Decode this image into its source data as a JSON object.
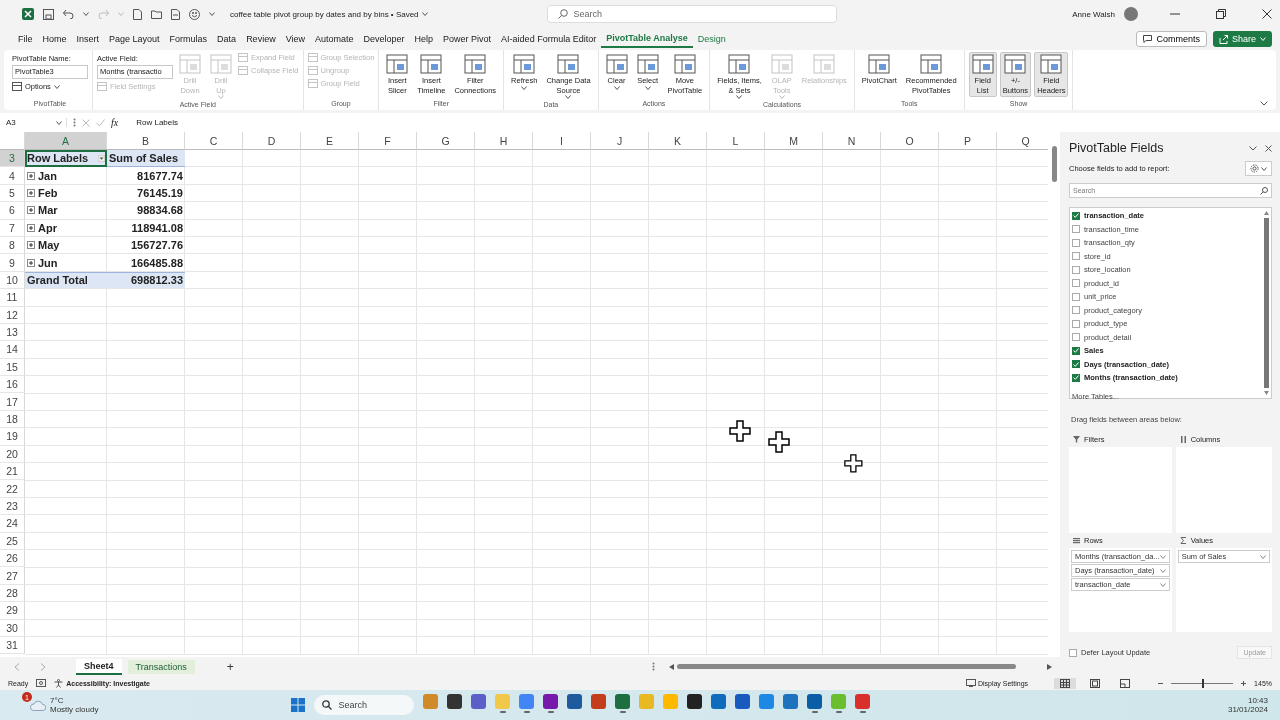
{
  "title_bar": {
    "document_title": "coffee table pivot group by dates and by bins • Saved",
    "search_placeholder": "Search",
    "user_name": "Anne Walsh"
  },
  "ribbon_tabs": [
    {
      "label": "File",
      "selected": false,
      "kind": "standard"
    },
    {
      "label": "Home",
      "selected": false,
      "kind": "standard"
    },
    {
      "label": "Insert",
      "selected": false,
      "kind": "standard"
    },
    {
      "label": "Page Layout",
      "selected": false,
      "kind": "standard"
    },
    {
      "label": "Formulas",
      "selected": false,
      "kind": "standard"
    },
    {
      "label": "Data",
      "selected": false,
      "kind": "standard"
    },
    {
      "label": "Review",
      "selected": false,
      "kind": "standard"
    },
    {
      "label": "View",
      "selected": false,
      "kind": "standard"
    },
    {
      "label": "Automate",
      "selected": false,
      "kind": "standard"
    },
    {
      "label": "Developer",
      "selected": false,
      "kind": "standard"
    },
    {
      "label": "Help",
      "selected": false,
      "kind": "standard"
    },
    {
      "label": "Power Pivot",
      "selected": false,
      "kind": "standard"
    },
    {
      "label": "AI-aided Formula Editor",
      "selected": false,
      "kind": "standard"
    },
    {
      "label": "PivotTable Analyse",
      "selected": true,
      "kind": "contextual"
    },
    {
      "label": "Design",
      "selected": false,
      "kind": "contextual"
    }
  ],
  "comments_button": "Comments",
  "share_button": "Share",
  "ribbon": {
    "groups": [
      {
        "label": "PivotTable",
        "columns": [
          [
            {
              "kind": "label",
              "text": "PivotTable Name:"
            },
            {
              "kind": "input",
              "value": "PivotTable3"
            },
            {
              "kind": "small",
              "label": "Options",
              "caret": true,
              "disabled": false
            }
          ]
        ]
      },
      {
        "label": "Active Field",
        "columns": [
          [
            {
              "kind": "label",
              "text": "Active Field:"
            },
            {
              "kind": "input",
              "value": "Months (transactio"
            },
            {
              "kind": "small",
              "label": "Field Settings",
              "caret": false,
              "disabled": true
            }
          ],
          [
            {
              "kind": "large",
              "lines": [
                "Drill",
                "Down"
              ],
              "caret": false,
              "disabled": true,
              "pressed": false
            }
          ],
          [
            {
              "kind": "large",
              "lines": [
                "Drill",
                "Up"
              ],
              "caret": true,
              "disabled": true,
              "pressed": false
            }
          ],
          [
            {
              "kind": "small",
              "label": "Expand Field",
              "caret": false,
              "disabled": true
            },
            {
              "kind": "small",
              "label": "Collapse Field",
              "caret": false,
              "disabled": true
            }
          ]
        ]
      },
      {
        "label": "Group",
        "columns": [
          [
            {
              "kind": "small",
              "label": "Group Selection",
              "caret": false,
              "disabled": true
            },
            {
              "kind": "small",
              "label": "Ungroup",
              "caret": false,
              "disabled": true
            },
            {
              "kind": "small",
              "label": "Group Field",
              "caret": false,
              "disabled": true
            }
          ]
        ]
      },
      {
        "label": "Filter",
        "columns": [
          [
            {
              "kind": "large",
              "lines": [
                "Insert",
                "Slicer"
              ],
              "caret": false,
              "disabled": false,
              "pressed": false
            }
          ],
          [
            {
              "kind": "large",
              "lines": [
                "Insert",
                "Timeline"
              ],
              "caret": false,
              "disabled": false,
              "pressed": false
            }
          ],
          [
            {
              "kind": "large",
              "lines": [
                "Filter",
                "Connections"
              ],
              "caret": false,
              "disabled": false,
              "pressed": false
            }
          ]
        ]
      },
      {
        "label": "Data",
        "columns": [
          [
            {
              "kind": "large",
              "lines": [
                "Refresh"
              ],
              "caret": true,
              "disabled": false,
              "pressed": false
            }
          ],
          [
            {
              "kind": "large",
              "lines": [
                "Change Data",
                "Source"
              ],
              "caret": true,
              "disabled": false,
              "pressed": false
            }
          ]
        ]
      },
      {
        "label": "Actions",
        "columns": [
          [
            {
              "kind": "large",
              "lines": [
                "Clear"
              ],
              "caret": true,
              "disabled": false,
              "pressed": false
            }
          ],
          [
            {
              "kind": "large",
              "lines": [
                "Select"
              ],
              "caret": true,
              "disabled": false,
              "pressed": false
            }
          ],
          [
            {
              "kind": "large",
              "lines": [
                "Move",
                "PivotTable"
              ],
              "caret": false,
              "disabled": false,
              "pressed": false
            }
          ]
        ]
      },
      {
        "label": "Calculations",
        "columns": [
          [
            {
              "kind": "large",
              "lines": [
                "Fields, Items,",
                "& Sets"
              ],
              "caret": true,
              "disabled": false,
              "pressed": false
            }
          ],
          [
            {
              "kind": "large",
              "lines": [
                "OLAP",
                "Tools"
              ],
              "caret": true,
              "disabled": true,
              "pressed": false
            }
          ],
          [
            {
              "kind": "large",
              "lines": [
                "Relationships"
              ],
              "caret": false,
              "disabled": true,
              "pressed": false
            }
          ]
        ]
      },
      {
        "label": "Tools",
        "columns": [
          [
            {
              "kind": "large",
              "lines": [
                "PivotChart"
              ],
              "caret": false,
              "disabled": false,
              "pressed": false
            }
          ],
          [
            {
              "kind": "large",
              "lines": [
                "Recommended",
                "PivotTables"
              ],
              "caret": false,
              "disabled": false,
              "pressed": false
            }
          ]
        ]
      },
      {
        "label": "Show",
        "columns": [
          [
            {
              "kind": "large",
              "lines": [
                "Field",
                "List"
              ],
              "caret": false,
              "disabled": false,
              "pressed": true
            }
          ],
          [
            {
              "kind": "large",
              "lines": [
                "+/-",
                "Buttons"
              ],
              "caret": false,
              "disabled": false,
              "pressed": true
            }
          ],
          [
            {
              "kind": "large",
              "lines": [
                "Field",
                "Headers"
              ],
              "caret": false,
              "disabled": false,
              "pressed": true
            }
          ]
        ]
      }
    ]
  },
  "formula_bar": {
    "name_box": "A3",
    "function_label": "fx",
    "formula": "Row Labels"
  },
  "sheet": {
    "columns": [
      {
        "label": "A",
        "selected": true
      },
      {
        "label": "B",
        "selected": false
      },
      {
        "label": "C",
        "selected": false
      },
      {
        "label": "D",
        "selected": false
      },
      {
        "label": "E",
        "selected": false
      },
      {
        "label": "F",
        "selected": false
      },
      {
        "label": "G",
        "selected": false
      },
      {
        "label": "H",
        "selected": false
      },
      {
        "label": "I",
        "selected": false
      },
      {
        "label": "J",
        "selected": false
      },
      {
        "label": "K",
        "selected": false
      },
      {
        "label": "L",
        "selected": false
      },
      {
        "label": "M",
        "selected": false
      },
      {
        "label": "N",
        "selected": false
      },
      {
        "label": "O",
        "selected": false
      },
      {
        "label": "P",
        "selected": false
      },
      {
        "label": "Q",
        "selected": false
      }
    ],
    "rows": [
      {
        "label": "3",
        "selected": true
      },
      {
        "label": "4",
        "selected": false
      },
      {
        "label": "5",
        "selected": false
      },
      {
        "label": "6",
        "selected": false
      },
      {
        "label": "7",
        "selected": false
      },
      {
        "label": "8",
        "selected": false
      },
      {
        "label": "9",
        "selected": false
      },
      {
        "label": "10",
        "selected": false
      },
      {
        "label": "11",
        "selected": false
      },
      {
        "label": "12",
        "selected": false
      },
      {
        "label": "13",
        "selected": false
      },
      {
        "label": "14",
        "selected": false
      },
      {
        "label": "15",
        "selected": false
      },
      {
        "label": "16",
        "selected": false
      },
      {
        "label": "17",
        "selected": false
      },
      {
        "label": "18",
        "selected": false
      },
      {
        "label": "19",
        "selected": false
      },
      {
        "label": "20",
        "selected": false
      },
      {
        "label": "21",
        "selected": false
      },
      {
        "label": "22",
        "selected": false
      },
      {
        "label": "23",
        "selected": false
      },
      {
        "label": "24",
        "selected": false
      },
      {
        "label": "25",
        "selected": false
      },
      {
        "label": "26",
        "selected": false
      },
      {
        "label": "27",
        "selected": false
      },
      {
        "label": "28",
        "selected": false
      },
      {
        "label": "29",
        "selected": false
      },
      {
        "label": "30",
        "selected": false
      },
      {
        "label": "31",
        "selected": false
      }
    ],
    "pivot": {
      "headers": [
        {
          "label": "Row Labels",
          "selected": true
        },
        {
          "label": "Sum of Sales",
          "selected": false
        }
      ],
      "rows": [
        {
          "label": "Jan",
          "value": "81677.74",
          "expanded": false
        },
        {
          "label": "Feb",
          "value": "76145.19",
          "expanded": false
        },
        {
          "label": "Mar",
          "value": "98834.68",
          "expanded": false
        },
        {
          "label": "Apr",
          "value": "118941.08",
          "expanded": false
        },
        {
          "label": "May",
          "value": "156727.76",
          "expanded": false
        },
        {
          "label": "Jun",
          "value": "166485.88",
          "expanded": false
        }
      ],
      "total": {
        "label": "Grand Total",
        "value": "698812.33"
      }
    }
  },
  "pivot_fields": {
    "title": "PivotTable Fields",
    "subtitle": "Choose fields to add to report:",
    "search_placeholder": "Search",
    "fields": [
      {
        "name": "transaction_date",
        "checked": true
      },
      {
        "name": "transaction_time",
        "checked": false
      },
      {
        "name": "transaction_qty",
        "checked": false
      },
      {
        "name": "store_id",
        "checked": false
      },
      {
        "name": "store_location",
        "checked": false
      },
      {
        "name": "product_id",
        "checked": false
      },
      {
        "name": "unit_price",
        "checked": false
      },
      {
        "name": "product_category",
        "checked": false
      },
      {
        "name": "product_type",
        "checked": false
      },
      {
        "name": "product_detail",
        "checked": false
      },
      {
        "name": "Sales",
        "checked": true
      },
      {
        "name": "Days (transaction_date)",
        "checked": true
      },
      {
        "name": "Months (transaction_date)",
        "checked": true
      }
    ],
    "more_tables": "More Tables...",
    "drag_hint": "Drag fields between areas below:",
    "areas": [
      {
        "label": "Filters",
        "kind": "filters"
      },
      {
        "label": "Columns",
        "kind": "columns"
      },
      {
        "label": "Rows",
        "kind": "rows",
        "items": [
          "Months (transaction_da...",
          "Days (transaction_date)",
          "transaction_date"
        ]
      },
      {
        "label": "Values",
        "kind": "values",
        "items": [
          "Sum of Sales"
        ]
      }
    ],
    "defer_update": {
      "label": "Defer Layout Update",
      "checked": false
    },
    "update_button": {
      "label": "Update",
      "disabled": true
    }
  },
  "sheet_tabs": [
    {
      "label": "Sheet4",
      "selected": true
    },
    {
      "label": "Transactions",
      "selected": false
    }
  ],
  "add_sheet": "+",
  "status_bar": {
    "mode": "Ready",
    "accessibility": "Accessibility: Investigate",
    "display_settings": "Display Settings",
    "views": [
      {
        "selected": true
      },
      {
        "selected": false
      },
      {
        "selected": false
      }
    ],
    "zoom": {
      "level": 0.5,
      "reading": "145%"
    }
  },
  "taskbar": {
    "weather": {
      "badge": "1",
      "temperature": "7°C",
      "condition": "Mostly cloudy"
    },
    "search_placeholder": "Search",
    "apps": [
      {
        "color": "#d08a2a",
        "running": false
      },
      {
        "color": "#333333",
        "running": false
      },
      {
        "color": "#5b5fc7",
        "running": false
      },
      {
        "color": "#f2c84b",
        "running": true
      },
      {
        "color": "#4285f4",
        "running": true
      },
      {
        "color": "#7719aa",
        "running": true
      },
      {
        "color": "#1e5a9e",
        "running": false
      },
      {
        "color": "#c43e1c",
        "running": false
      },
      {
        "color": "#1d6f42",
        "running": true
      },
      {
        "color": "#e8b923",
        "running": false
      },
      {
        "color": "#ffb900",
        "running": false
      },
      {
        "color": "#222222",
        "running": false
      },
      {
        "color": "#0f6cbd",
        "running": false
      },
      {
        "color": "#185abd",
        "running": false
      },
      {
        "color": "#1e88e5",
        "running": false
      },
      {
        "color": "#1e73be",
        "running": false
      },
      {
        "color": "#0a5ea8",
        "running": true
      },
      {
        "color": "#6abf2e",
        "running": true
      },
      {
        "color": "#d9302c",
        "running": true
      }
    ],
    "time": "10:43",
    "date": "31/01/2024"
  }
}
